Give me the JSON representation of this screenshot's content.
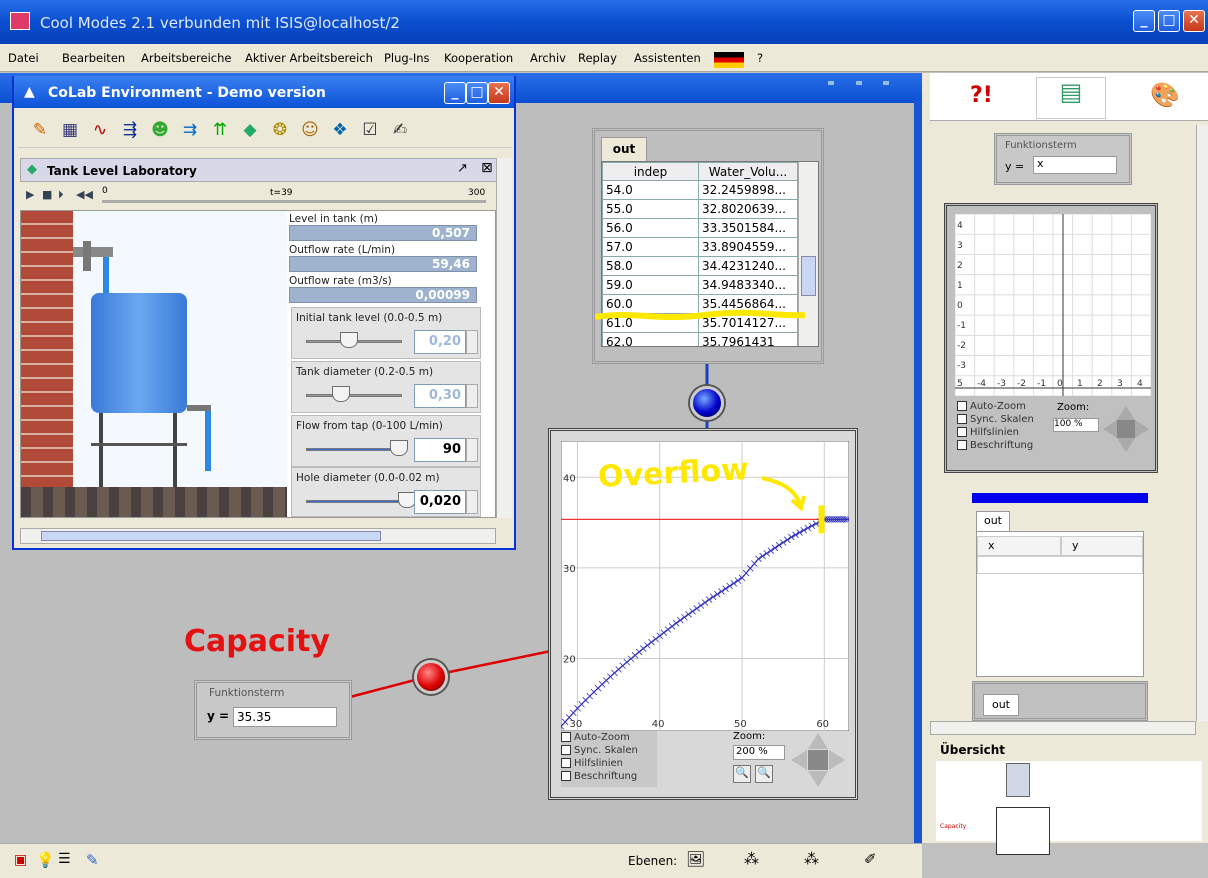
{
  "window": {
    "title": "Cool Modes 2.1 verbunden mit ISIS@localhost/2"
  },
  "menu": [
    "Datei",
    "Bearbeiten",
    "Arbeitsbereiche",
    "Aktiver Arbeitsbereich",
    "Plug-Ins",
    "Kooperation",
    "Archiv",
    "Replay",
    "Assistenten",
    "?"
  ],
  "colab": {
    "title": "CoLab Environment - Demo version",
    "lab_title": "Tank Level Laboratory",
    "t_label": "t=39",
    "slider_start": "0",
    "slider_end": "300",
    "readouts": [
      {
        "label": "Level in tank (m)",
        "value": "0,507"
      },
      {
        "label": "Outflow rate (L/min)",
        "value": "59,46"
      },
      {
        "label": "Outflow rate (m3/s)",
        "value": "0,00099"
      }
    ],
    "params": [
      {
        "label": "Initial tank level (0.0-0.5 m)",
        "value": "0,20"
      },
      {
        "label": "Tank diameter (0.2-0.5 m)",
        "value": "0,30"
      },
      {
        "label": "Flow from tap (0-100 L/min)",
        "value": "90"
      },
      {
        "label": "Hole diameter (0.0-0.02 m)",
        "value": "0,020"
      }
    ]
  },
  "out_table": {
    "tab": "out",
    "headers": [
      "indep",
      "Water_Volu..."
    ],
    "rows": [
      [
        "54.0",
        "32.2459898..."
      ],
      [
        "55.0",
        "32.8020639..."
      ],
      [
        "56.0",
        "33.3501584..."
      ],
      [
        "57.0",
        "33.8904559..."
      ],
      [
        "58.0",
        "34.4231240..."
      ],
      [
        "59.0",
        "34.9483340..."
      ],
      [
        "60.0",
        "35.4456864..."
      ],
      [
        "61.0",
        "35.7014127..."
      ],
      [
        "62.0",
        "35.7961431"
      ]
    ]
  },
  "graph": {
    "controls": [
      "Auto-Zoom",
      "Sync. Skalen",
      "Hilfslinien",
      "Beschriftung"
    ],
    "zoom_label": "Zoom:",
    "zoom_value": "200 %"
  },
  "chart_data": {
    "type": "line",
    "xlim": [
      28,
      63
    ],
    "ylim": [
      12,
      44
    ],
    "xticks": [
      "30",
      "40",
      "50",
      "60"
    ],
    "yticks": [
      "20",
      "30",
      "40"
    ],
    "capacity_line": 35.35,
    "x": [
      28,
      30,
      32,
      34,
      36,
      38,
      40,
      42,
      44,
      46,
      48,
      50,
      52,
      54,
      56,
      58,
      60,
      61,
      62,
      63
    ],
    "values": [
      12.5,
      14.5,
      16.3,
      18.0,
      19.6,
      21.1,
      22.5,
      23.9,
      25.2,
      26.5,
      27.7,
      28.9,
      31.0,
      32.2,
      33.4,
      34.4,
      35.35,
      35.35,
      35.35,
      35.35
    ]
  },
  "capacity_fn": {
    "box_title": "Funktionsterm",
    "y_label": "y =",
    "value": "35.35"
  },
  "annotations": {
    "overflow": "Overflow",
    "capacity": "Capacity"
  },
  "right": {
    "fn_box_title": "Funktionsterm",
    "fn_y_label": "y =",
    "fn_value": "x",
    "mini_yticks": [
      "4",
      "3",
      "2",
      "1",
      "0",
      "-1",
      "-2",
      "-3"
    ],
    "mini_xticks": [
      "5",
      "-4",
      "-3",
      "-2",
      "-1",
      "0",
      "1",
      "2",
      "3",
      "4"
    ],
    "mini_controls": [
      "Auto-Zoom",
      "Sync. Skalen",
      "Hilfslinien",
      "Beschriftung"
    ],
    "mini_zoom_label": "Zoom:",
    "mini_zoom_value": "100 %",
    "table_tab": "out",
    "table_headers": [
      "x",
      "y"
    ],
    "out2_tab": "out",
    "overview": "Übersicht",
    "ov_label": "Capacity"
  },
  "bottom": {
    "layers_label": "Ebenen:"
  }
}
